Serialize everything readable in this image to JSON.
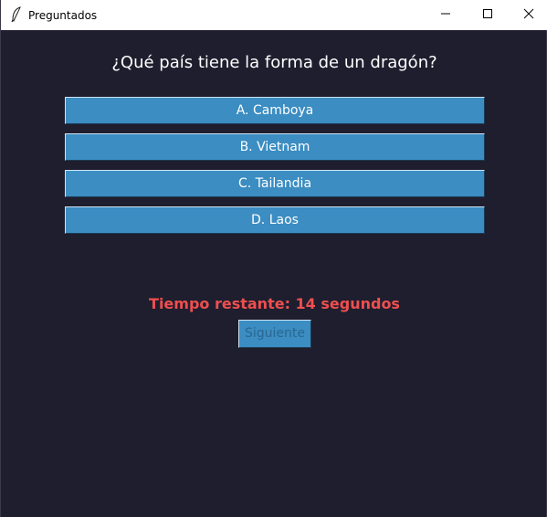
{
  "window": {
    "title": "Preguntados"
  },
  "quiz": {
    "question": "¿Qué país tiene la forma de un dragón?",
    "options": [
      {
        "label": "A. Camboya"
      },
      {
        "label": "B. Vietnam"
      },
      {
        "label": "C. Tailandia"
      },
      {
        "label": "D. Laos"
      }
    ],
    "timer_text": "Tiempo restante: 14 segundos",
    "next_label": "Siguiente",
    "next_enabled": false
  },
  "colors": {
    "background": "#1e1e2e",
    "button": "#3b8dc2",
    "timer": "#ee4f4f"
  },
  "icons": {
    "app": "feather-icon",
    "minimize": "minimize-icon",
    "maximize": "maximize-icon",
    "close": "close-icon"
  }
}
